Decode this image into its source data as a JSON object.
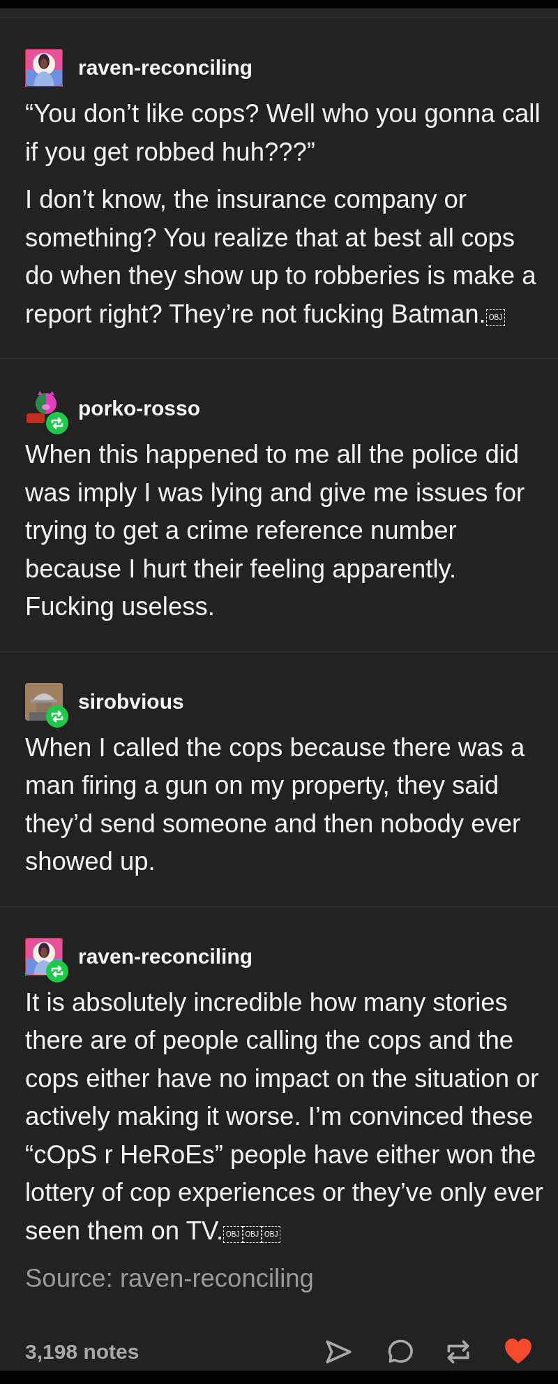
{
  "posts": [
    {
      "username": "raven-reconciling",
      "avatar": {
        "kind": "raven"
      },
      "reblogged": false,
      "paragraphs": [
        "“You don’t like cops? Well who you gonna call if you get robbed huh???”",
        "I don’t know, the insurance company or something? You realize that at best all cops do when they show up to robberies is make a report right? They’re not fucking Batman."
      ],
      "obj_marks": [
        "OBJ"
      ]
    },
    {
      "username": "porko-rosso",
      "avatar": {
        "kind": "pig"
      },
      "reblogged": true,
      "paragraphs": [
        "When this happened to me all the police did was imply I was lying and give me issues for trying to get a crime reference number because I hurt their feeling apparently. Fucking useless."
      ]
    },
    {
      "username": "sirobvious",
      "avatar": {
        "kind": "knight"
      },
      "reblogged": true,
      "paragraphs": [
        "When I called the cops because there was a man firing a gun on my property, they said they’d send someone and then nobody ever showed up."
      ]
    },
    {
      "username": "raven-reconciling",
      "avatar": {
        "kind": "raven"
      },
      "reblogged": true,
      "paragraphs": [
        "It is absolutely incredible how many stories there are of people calling the cops and the cops either have no impact on the situation or actively making it worse. I’m convinced these “cOpS r HeRoEs” people have either won the lottery of cop experiences or they’ve only ever seen them on TV."
      ],
      "obj_marks": [
        "OBJ",
        "OBJ",
        "OBJ"
      ]
    }
  ],
  "source": "Source: raven-reconciling",
  "notes": "3,198 notes",
  "liked": true
}
